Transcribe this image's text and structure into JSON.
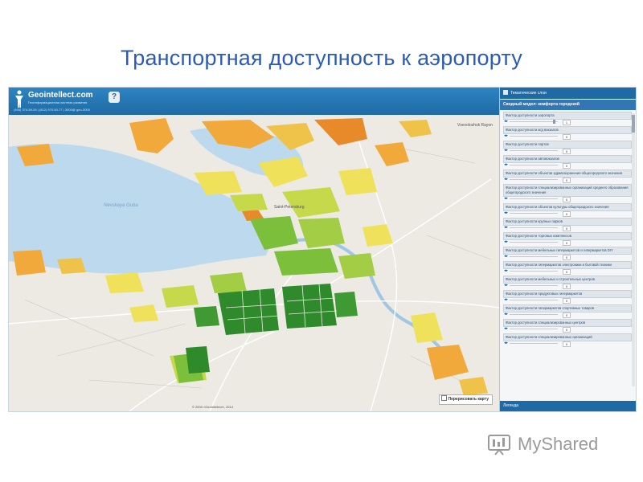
{
  "slide": {
    "title": "Транспортная доступность к аэропорту"
  },
  "app": {
    "logo_text": "Geointellect.com",
    "logo_subtitle": "Геоинформационная система развития",
    "logo_contacts": "(495) 374-59-54 | (812) 970-50-77 | 3000@ geo-3000",
    "help_label": "?",
    "redraw_label": "Перерисовать карту",
    "attribution": "© 2000 «GeoIntellect», 2014"
  },
  "map": {
    "water_label": "Nevskaya Guba",
    "places": [
      "Saint-Petersburg",
      "Vsevolozhsk Rayon"
    ],
    "colors": {
      "water": "#bcd9ee",
      "land": "#eceae3",
      "dark_green": "#2f8a2c",
      "green": "#7bbf3a",
      "yellow_green": "#c6d94a",
      "yellow": "#efe15a",
      "orange": "#f2a93b",
      "dark_orange": "#e98a2a"
    }
  },
  "panel": {
    "header": "Тематические слои",
    "model_title": "Сводный модел: комфорта городской",
    "legend_label": "Легенда",
    "factors": [
      {
        "label": "Фактор доступности аэропорта",
        "value": "1"
      },
      {
        "label": "Фактор доступности ж/д вокзалов",
        "value": "0"
      },
      {
        "label": "Фактор доступности портов",
        "value": "0"
      },
      {
        "label": "Фактор доступности автовокзалов",
        "value": "0"
      },
      {
        "label": "Фактор доступности объектов здравоохранения общегородского значения",
        "value": "0"
      },
      {
        "label": "Фактор доступности специализированных организаций среднего образования общегородского значения",
        "value": "0"
      },
      {
        "label": "Фактор доступности объектов культуры общегородского значения",
        "value": "0"
      },
      {
        "label": "Фактор доступности крупных парков",
        "value": "0"
      },
      {
        "label": "Фактор доступности торговых комплексов",
        "value": "0"
      },
      {
        "label": "Фактор доступности мебельных гипермаркетов и гипермаркетов DIY",
        "value": "0"
      },
      {
        "label": "Фактор доступности гипермаркетов электроники и бытовой техники",
        "value": "0"
      },
      {
        "label": "Фактор доступности мебельных и строительных центров",
        "value": "0"
      },
      {
        "label": "Фактор доступности продуктовых гипермаркетов",
        "value": "0"
      },
      {
        "label": "Фактор доступности гипермаркетов спортивных товаров",
        "value": "0"
      },
      {
        "label": "Фактор доступности специализированных центров",
        "value": "0"
      },
      {
        "label": "Фактор доступности специализированных организаций",
        "value": "0"
      }
    ]
  },
  "watermark": {
    "text": "MyShared"
  }
}
